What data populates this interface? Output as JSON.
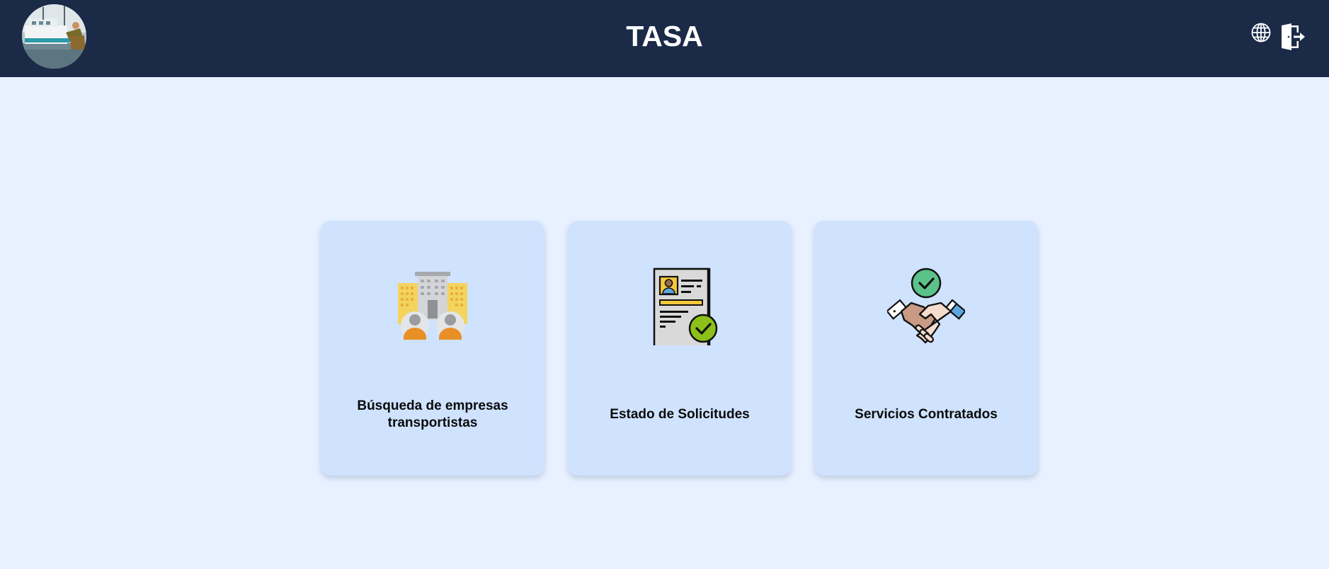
{
  "header": {
    "title": "TASA",
    "background_color": "#1b2a47",
    "avatar_icon": "user-avatar",
    "language_icon": "globe-icon",
    "logout_icon": "logout-door-icon"
  },
  "main": {
    "background_color": "#e8f1ff",
    "card_color": "#cfe2fe",
    "cards": [
      {
        "label": "Búsqueda de empresas transportistas",
        "icon": "buildings-people-icon"
      },
      {
        "label": "Estado de Solicitudes",
        "icon": "document-check-icon"
      },
      {
        "label": "Servicios Contratados",
        "icon": "handshake-check-icon"
      }
    ]
  }
}
